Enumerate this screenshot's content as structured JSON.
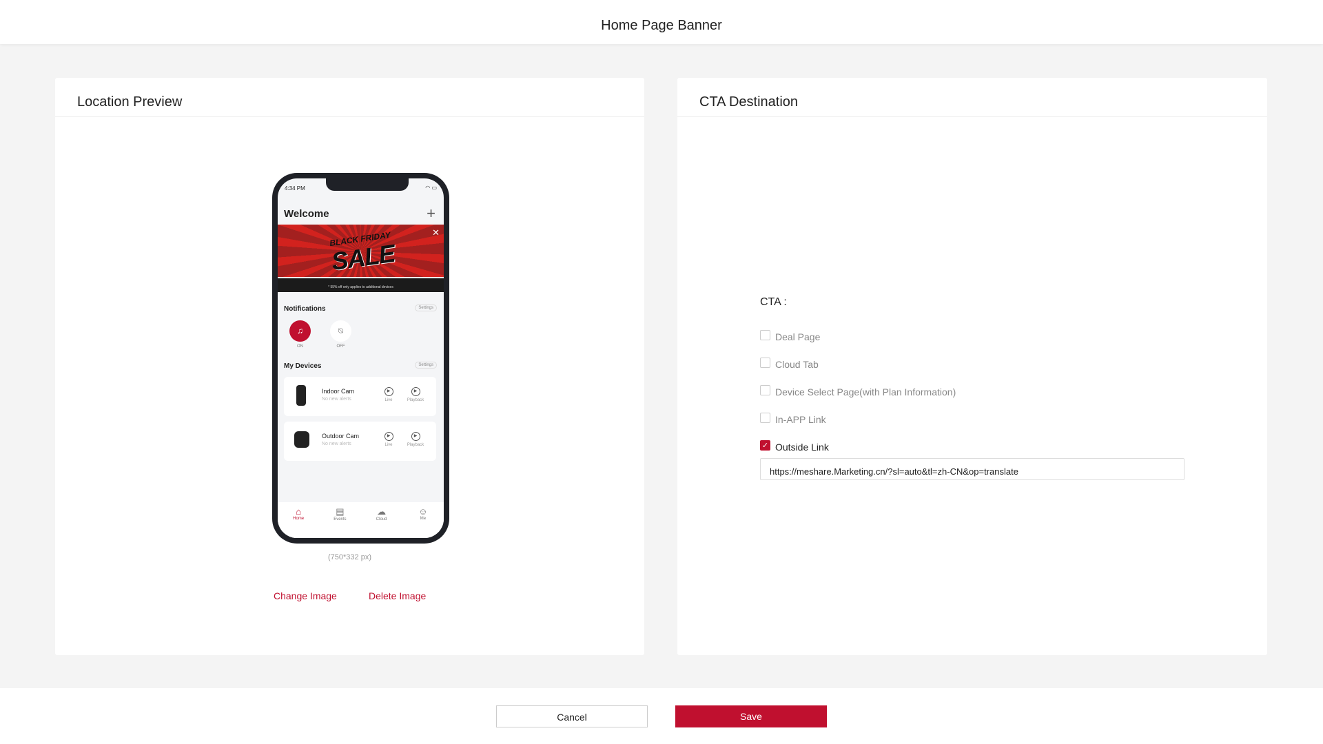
{
  "header": {
    "title": "Home Page Banner"
  },
  "preview": {
    "title": "Location Preview",
    "phone": {
      "time": "4:34 PM",
      "welcome": "Welcome",
      "banner_top": "BLACK FRIDAY",
      "banner_main": "SALE",
      "banner_note": "* 55% off only applies to additional devices",
      "notifications": "Notifications",
      "settings": "Settings",
      "on": "ON",
      "off": "OFF",
      "my_devices": "My Devices",
      "devices": [
        {
          "name": "Indoor Cam",
          "status": "No new alerts"
        },
        {
          "name": "Outdoor Cam",
          "status": "No new alerts"
        }
      ],
      "live": "Live",
      "playback": "Playback",
      "tabs": [
        {
          "label": "Home",
          "icon": "home-icon"
        },
        {
          "label": "Events",
          "icon": "document-icon"
        },
        {
          "label": "Cloud",
          "icon": "cloud-icon"
        },
        {
          "label": "Me",
          "icon": "user-icon"
        }
      ],
      "accent": "#c0102f"
    },
    "size_hint": "(750*332 px)",
    "change_image": "Change Image",
    "delete_image": "Delete Image"
  },
  "cta": {
    "title": "CTA Destination",
    "label": "CTA :",
    "options": [
      {
        "label": "Deal Page",
        "checked": false
      },
      {
        "label": "Cloud Tab",
        "checked": false
      },
      {
        "label": "Device Select Page(with Plan Information)",
        "checked": false
      },
      {
        "label": "In-APP Link",
        "checked": false
      },
      {
        "label": "Outside Link",
        "checked": true
      }
    ],
    "url": "https://meshare.Marketing.cn/?sl=auto&tl=zh-CN&op=translate"
  },
  "footer": {
    "cancel": "Cancel",
    "save": "Save"
  }
}
